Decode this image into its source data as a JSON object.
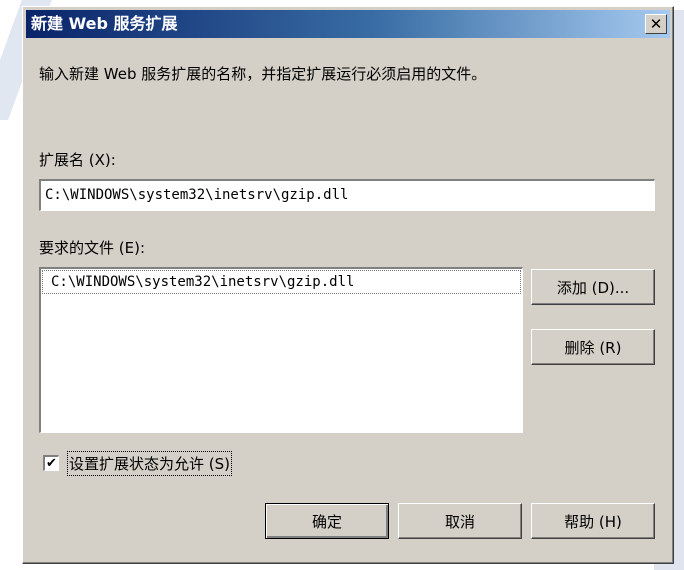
{
  "window": {
    "title": "新建 Web 服务扩展",
    "close_glyph": "✕"
  },
  "description": "输入新建 Web 服务扩展的名称，并指定扩展运行必须启用的文件。",
  "extension_name": {
    "label": "扩展名 (X):",
    "value": "C:\\WINDOWS\\system32\\inetsrv\\gzip.dll"
  },
  "required_files": {
    "label": "要求的文件 (E):",
    "items": [
      "C:\\WINDOWS\\system32\\inetsrv\\gzip.dll"
    ]
  },
  "buttons": {
    "add": "添加 (D)...",
    "remove": "删除 (R)",
    "ok": "确定",
    "cancel": "取消",
    "help": "帮助 (H)"
  },
  "checkbox": {
    "label": "设置扩展状态为允许 (S)",
    "checked": true,
    "check_glyph": "✔"
  },
  "colors": {
    "dialog_bg": "#d4d0c8",
    "title_start": "#0a246a",
    "title_end": "#a6caf0"
  }
}
